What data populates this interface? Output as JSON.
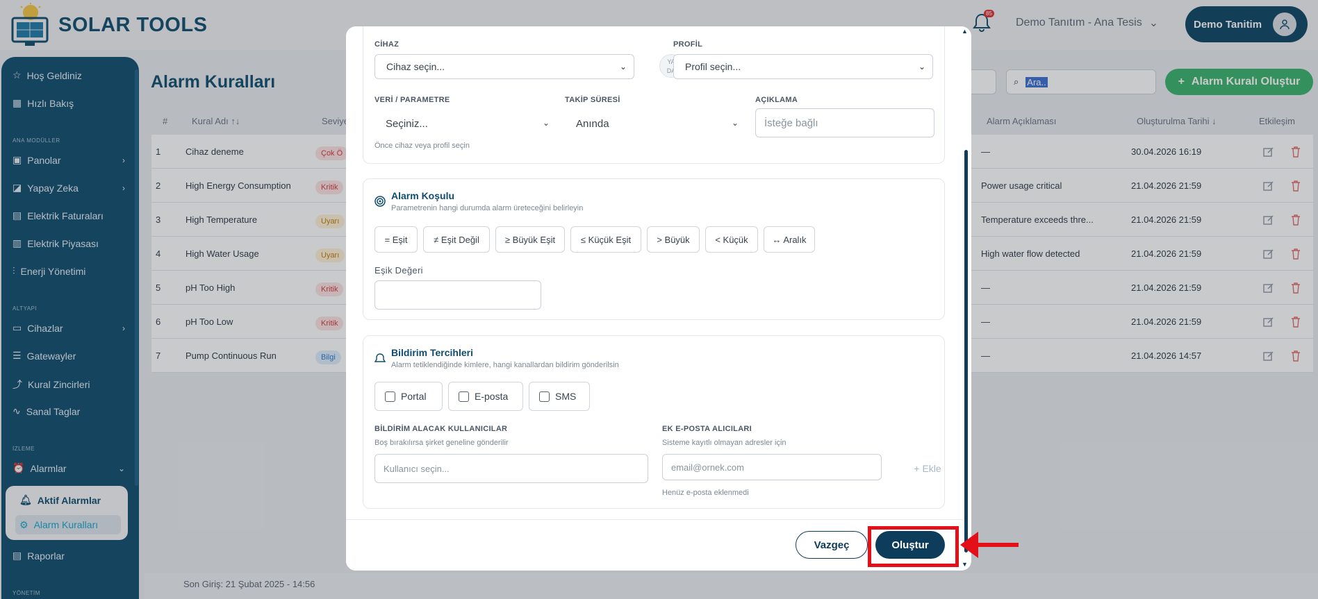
{
  "brand": {
    "name": "SOLAR TOOLS"
  },
  "header": {
    "notification_count": "85",
    "tenant_label": "Demo Tanıtım - Ana Tesis",
    "user_label": "Demo Tanitim"
  },
  "sidebar": {
    "items": [
      {
        "label": "Hoş Geldiniz"
      },
      {
        "label": "Hızlı Bakış"
      },
      {
        "label": "Panolar"
      },
      {
        "label": "Yapay Zeka"
      },
      {
        "label": "Elektrik Faturaları"
      },
      {
        "label": "Elektrik Piyasası"
      },
      {
        "label": "Enerji Yönetimi"
      },
      {
        "label": "Cihazlar"
      },
      {
        "label": "Gatewayler"
      },
      {
        "label": "Kural Zincirleri"
      },
      {
        "label": "Sanal Taglar"
      },
      {
        "label": "Alarmlar"
      },
      {
        "label": "Raporlar"
      }
    ],
    "sections": [
      "ANA MODÜLLER",
      "ALTYAPI",
      "İZLEME",
      "YÖNETİM"
    ],
    "alarm_sub": [
      {
        "label": "Aktif Alarmlar"
      },
      {
        "label": "Alarm Kuralları"
      }
    ]
  },
  "page": {
    "title": "Alarm Kuralları",
    "search_value": "Ara..",
    "create_label": "Alarm Kuralı Oluştur",
    "footer_text": "Son Giriş: 21 Şubat 2025 - 14:56"
  },
  "table": {
    "headers": [
      "#",
      "Kural Adı ↑↓",
      "Seviye",
      "Alarm Açıklaması",
      "Oluşturulma Tarihi ↓",
      "Etkileşim"
    ],
    "rows": [
      {
        "num": "1",
        "name": "Cihaz deneme",
        "level": "Çok Ö",
        "level_type": "crit",
        "desc": "—",
        "date": "30.04.2026 16:19"
      },
      {
        "num": "2",
        "name": "High Energy Consumption",
        "level": "Kritik",
        "level_type": "crit",
        "desc": "Power usage critical",
        "date": "21.04.2026 21:59"
      },
      {
        "num": "3",
        "name": "High Temperature",
        "level": "Uyarı",
        "level_type": "warn",
        "desc": "Temperature exceeds thre...",
        "date": "21.04.2026 21:59"
      },
      {
        "num": "4",
        "name": "High Water Usage",
        "level": "Uyarı",
        "level_type": "warn",
        "desc": "High water flow detected",
        "date": "21.04.2026 21:59"
      },
      {
        "num": "5",
        "name": "pH Too High",
        "level": "Kritik",
        "level_type": "crit",
        "desc": "—",
        "date": "21.04.2026 21:59"
      },
      {
        "num": "6",
        "name": "pH Too Low",
        "level": "Kritik",
        "level_type": "crit",
        "desc": "—",
        "date": "21.04.2026 21:59"
      },
      {
        "num": "7",
        "name": "Pump Continuous Run",
        "level": "Bilgi",
        "level_type": "info",
        "desc": "—",
        "date": "21.04.2026 14:57"
      }
    ]
  },
  "modal": {
    "device": {
      "label": "CİHAZ",
      "placeholder": "Cihaz seçin..."
    },
    "or_label_1": "YA",
    "or_label_2": "DA",
    "profile": {
      "label": "PROFİL",
      "placeholder": "Profil seçin..."
    },
    "param": {
      "label": "VERİ / PARAMETRE",
      "value": "Seçiniz...",
      "hint": "Önce cihaz veya profil seçin"
    },
    "duration": {
      "label": "TAKİP SÜRESİ",
      "value": "Anında"
    },
    "description": {
      "label": "AÇIKLAMA",
      "placeholder": "İsteğe bağlı"
    },
    "condition": {
      "title": "Alarm Koşulu",
      "subtitle": "Parametrenin hangi durumda alarm üreteceğini belirleyin",
      "operators": [
        "= Eşit",
        "≠ Eşit Değil",
        "≥ Büyük Eşit",
        "≤ Küçük Eşit",
        "> Büyük",
        "< Küçük",
        "↔ Aralık"
      ],
      "threshold_label": "Eşik Değeri"
    },
    "notify": {
      "title": "Bildirim Tercihleri",
      "subtitle": "Alarm tetiklendiğinde kimlere, hangi kanallardan bildirim gönderilsin",
      "channels": [
        "Portal",
        "E-posta",
        "SMS"
      ],
      "users_label": "BİLDİRİM ALACAK KULLANICILAR",
      "users_hint": "Boş bırakılırsa şirket geneline gönderilir",
      "users_placeholder": "Kullanıcı seçin...",
      "email_label": "EK E-POSTA ALICILARI",
      "email_hint": "Sisteme kayıtlı olmayan adresler için",
      "email_placeholder": "email@ornek.com",
      "add_label": "Ekle",
      "email_empty": "Henüz e-posta eklenmedi"
    },
    "cancel_label": "Vazgeç",
    "submit_label": "Oluştur"
  },
  "colors": {
    "brand": "#0f4c6e",
    "accent_green": "#38b26b",
    "highlight_red": "#e3101a"
  }
}
